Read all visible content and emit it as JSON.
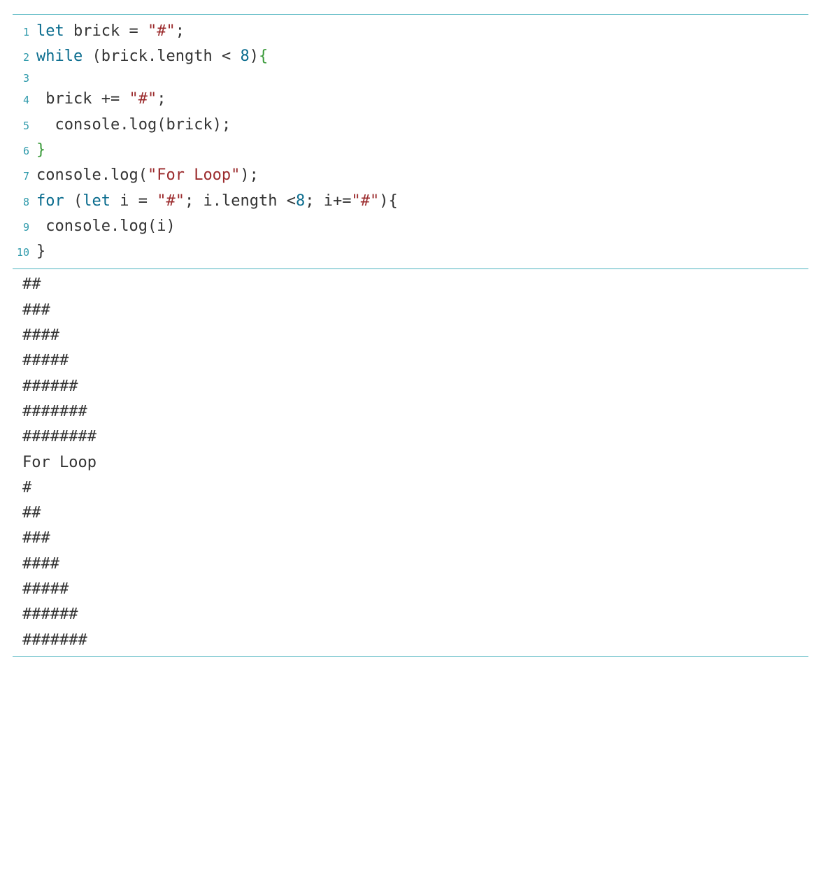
{
  "code": {
    "lines": [
      {
        "n": "1",
        "tokens": [
          [
            "kw",
            "let"
          ],
          [
            "punct",
            " "
          ],
          [
            "id",
            "brick"
          ],
          [
            "punct",
            " "
          ],
          [
            "punct",
            "="
          ],
          [
            "punct",
            " "
          ],
          [
            "str",
            "\"#\""
          ],
          [
            "punct",
            ";"
          ]
        ]
      },
      {
        "n": "2",
        "tokens": [
          [
            "kw",
            "while"
          ],
          [
            "punct",
            " "
          ],
          [
            "punct",
            "("
          ],
          [
            "id",
            "brick"
          ],
          [
            "punct",
            "."
          ],
          [
            "id",
            "length"
          ],
          [
            "punct",
            " "
          ],
          [
            "punct",
            "<"
          ],
          [
            "punct",
            " "
          ],
          [
            "num",
            "8"
          ],
          [
            "punct",
            ")"
          ],
          [
            "bracket-open",
            "{"
          ]
        ]
      },
      {
        "n": "3",
        "tokens": []
      },
      {
        "n": "4",
        "tokens": [
          [
            "punct",
            " "
          ],
          [
            "id",
            "brick"
          ],
          [
            "punct",
            " "
          ],
          [
            "punct",
            "+="
          ],
          [
            "punct",
            " "
          ],
          [
            "str",
            "\"#\""
          ],
          [
            "punct",
            ";"
          ]
        ]
      },
      {
        "n": "5",
        "tokens": [
          [
            "punct",
            "  "
          ],
          [
            "id",
            "console"
          ],
          [
            "punct",
            "."
          ],
          [
            "id",
            "log"
          ],
          [
            "punct",
            "("
          ],
          [
            "id",
            "brick"
          ],
          [
            "punct",
            ")"
          ],
          [
            "punct",
            ";"
          ]
        ]
      },
      {
        "n": "6",
        "tokens": [
          [
            "bracket-close",
            "}"
          ]
        ]
      },
      {
        "n": "7",
        "tokens": [
          [
            "id",
            "console"
          ],
          [
            "punct",
            "."
          ],
          [
            "id",
            "log"
          ],
          [
            "punct",
            "("
          ],
          [
            "str",
            "\"For Loop\""
          ],
          [
            "punct",
            ")"
          ],
          [
            "punct",
            ";"
          ]
        ]
      },
      {
        "n": "8",
        "tokens": [
          [
            "kw",
            "for"
          ],
          [
            "punct",
            " "
          ],
          [
            "punct",
            "("
          ],
          [
            "kw",
            "let"
          ],
          [
            "punct",
            " "
          ],
          [
            "id",
            "i"
          ],
          [
            "punct",
            " "
          ],
          [
            "punct",
            "="
          ],
          [
            "punct",
            " "
          ],
          [
            "str",
            "\"#\""
          ],
          [
            "punct",
            ";"
          ],
          [
            "punct",
            " "
          ],
          [
            "id",
            "i"
          ],
          [
            "punct",
            "."
          ],
          [
            "id",
            "length"
          ],
          [
            "punct",
            " "
          ],
          [
            "punct",
            "<"
          ],
          [
            "num",
            "8"
          ],
          [
            "punct",
            ";"
          ],
          [
            "punct",
            " "
          ],
          [
            "id",
            "i"
          ],
          [
            "punct",
            "+="
          ],
          [
            "str",
            "\"#\""
          ],
          [
            "punct",
            ")"
          ],
          [
            "punct",
            "{"
          ]
        ]
      },
      {
        "n": "9",
        "tokens": [
          [
            "punct",
            " "
          ],
          [
            "id",
            "console"
          ],
          [
            "punct",
            "."
          ],
          [
            "id",
            "log"
          ],
          [
            "punct",
            "("
          ],
          [
            "id",
            "i"
          ],
          [
            "punct",
            ")"
          ]
        ]
      },
      {
        "n": "10",
        "tokens": [
          [
            "punct",
            "}"
          ]
        ]
      }
    ]
  },
  "output": {
    "lines": [
      "##",
      "###",
      "####",
      "#####",
      "######",
      "#######",
      "########",
      "For Loop",
      "#",
      "##",
      "###",
      "####",
      "#####",
      "######",
      "#######"
    ]
  }
}
